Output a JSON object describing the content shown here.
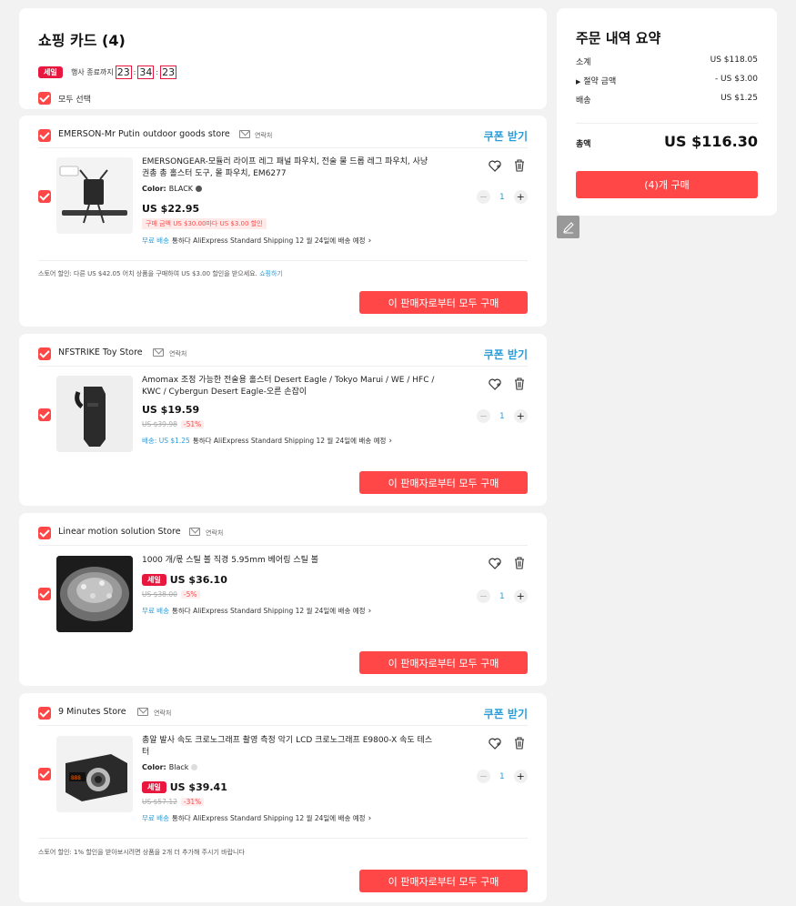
{
  "header": {
    "title": "쇼핑 카드 (4)",
    "sale_badge": "세일",
    "timer_label": "행사 종료까지",
    "timer": [
      "23",
      "34",
      "23"
    ],
    "select_all": "모두 선택"
  },
  "common": {
    "contact": "연락처",
    "coupon": "쿠폰 받기",
    "buy_all": "이 판매자로부터 모두 구매",
    "sale": "세일",
    "qty_minus": "−",
    "qty_plus": "+"
  },
  "stores": [
    {
      "name": "EMERSON-Mr Putin outdoor goods store",
      "product": {
        "name": "EMERSONGEAR-모듈러 라이프 레그 패널 파우치, 전술 물 드롭 레그 파우치, 사냥 권총 총 홀스터 도구, 몰 파우치, EM6277",
        "attr_label": "Color:",
        "attr_value": "BLACK",
        "price": "US $22.95",
        "promo": "구매 금액 US $30.00마다 US $3.00 할인",
        "ship_blue": "무료 배송",
        "ship_text": "통하다 AliExpress Standard Shipping 12 월 24일에 배송 예정",
        "qty": "1"
      },
      "store_discount": "스토어 할인: 다른 US $42.05 어치 상품을 구매하여 US $3.00 할인을 받으세요.",
      "store_discount_link": "쇼핑하기"
    },
    {
      "name": "NFSTRIKE Toy Store",
      "product": {
        "name": "Amomax 조정 가능한 전술용 홀스터 Desert Eagle / Tokyo Marui / WE / HFC / KWC / Cybergun Desert Eagle-오른 손잡이",
        "price": "US $19.59",
        "old_price": "US $39.98",
        "discount": "-51%",
        "ship_blue": "배송: US $1.25",
        "ship_text": "통하다 AliExpress Standard Shipping 12 월 24일에 배송 예정",
        "qty": "1"
      }
    },
    {
      "name": "Linear motion solution Store",
      "product": {
        "name": "1000 개/몫 스틸 볼 직경 5.95mm 베어링 스틸 볼",
        "price": "US $36.10",
        "old_price": "US $38.00",
        "discount": "-5%",
        "ship_blue": "무료 배송",
        "ship_text": "통하다 AliExpress Standard Shipping 12 월 24일에 배송 예정",
        "qty": "1"
      }
    },
    {
      "name": "9 Minutes Store",
      "product": {
        "name": "총알 발사 속도 크로노그래프 촬영 측정 악기 LCD 크로노그래프 E9800-X 속도 테스터",
        "attr_label": "Color:",
        "attr_value": "Black",
        "price": "US $39.41",
        "old_price": "US $57.12",
        "discount": "-31%",
        "ship_blue": "무료 배송",
        "ship_text": "통하다 AliExpress Standard Shipping 12 월 24일에 배송 예정",
        "qty": "1"
      },
      "store_discount": "스토어 할인: 1% 할인을 받아보시려면 상품을 2개 더 추가해 주시기 바랍니다"
    }
  ],
  "summary": {
    "title": "주문 내역 요약",
    "subtotal_label": "소계",
    "subtotal": "US $118.05",
    "savings_label": "절약 금액",
    "savings": "- US $3.00",
    "shipping_label": "배송",
    "shipping": "US $1.25",
    "total_label": "총액",
    "total": "US $116.30",
    "buy_label": "(4)개 구매"
  },
  "colors": {
    "accent": "#ff4747",
    "sale": "#e8173e",
    "link": "#2e9cd7"
  }
}
